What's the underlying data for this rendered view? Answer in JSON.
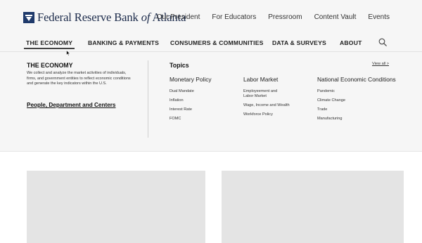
{
  "header": {
    "logo_text_main": "Federal Reserve Bank ",
    "logo_text_italic": "of",
    "logo_text_end": " Atlanta",
    "logo_icon": "bank-seal-icon",
    "utility_links": [
      "Our President",
      "For Educators",
      "Pressroom",
      "Content Vault",
      "Events"
    ]
  },
  "nav": {
    "items": [
      "THE ECONOMY",
      "BANKING & PAYMENTS",
      "CONSUMERS & COMMUNITIES",
      "DATA & SURVEYS",
      "ABOUT"
    ],
    "active": "THE ECONOMY",
    "search_icon": "search-icon"
  },
  "mega": {
    "left_title": "THE ECONOMY",
    "left_desc": "We collect and analyze the market activities of individuals, firms, and government entities to reflect economic conditions and generate the key indicators within the U.S.",
    "left_link": "People, Department and Centers",
    "topics_title": "Topics",
    "view_all": "View all >",
    "columns": [
      {
        "title": "Monetary Policy",
        "links": [
          "Dual Mandate",
          "Inflation",
          "Interest Rate",
          "FOMC"
        ]
      },
      {
        "title": "Labor Market",
        "links": [
          "Employeement and Labor Market",
          "Wage, Income and Wealth",
          "Workforce Policy"
        ]
      },
      {
        "title": "National Economic Conditions",
        "links": [
          "Pandemic",
          "Climate Change",
          "Trade",
          "Manufacturing"
        ]
      }
    ]
  },
  "colors": {
    "brand": "#1f3a6b",
    "background": "#f6f6f6",
    "card": "#e4e4e4"
  }
}
